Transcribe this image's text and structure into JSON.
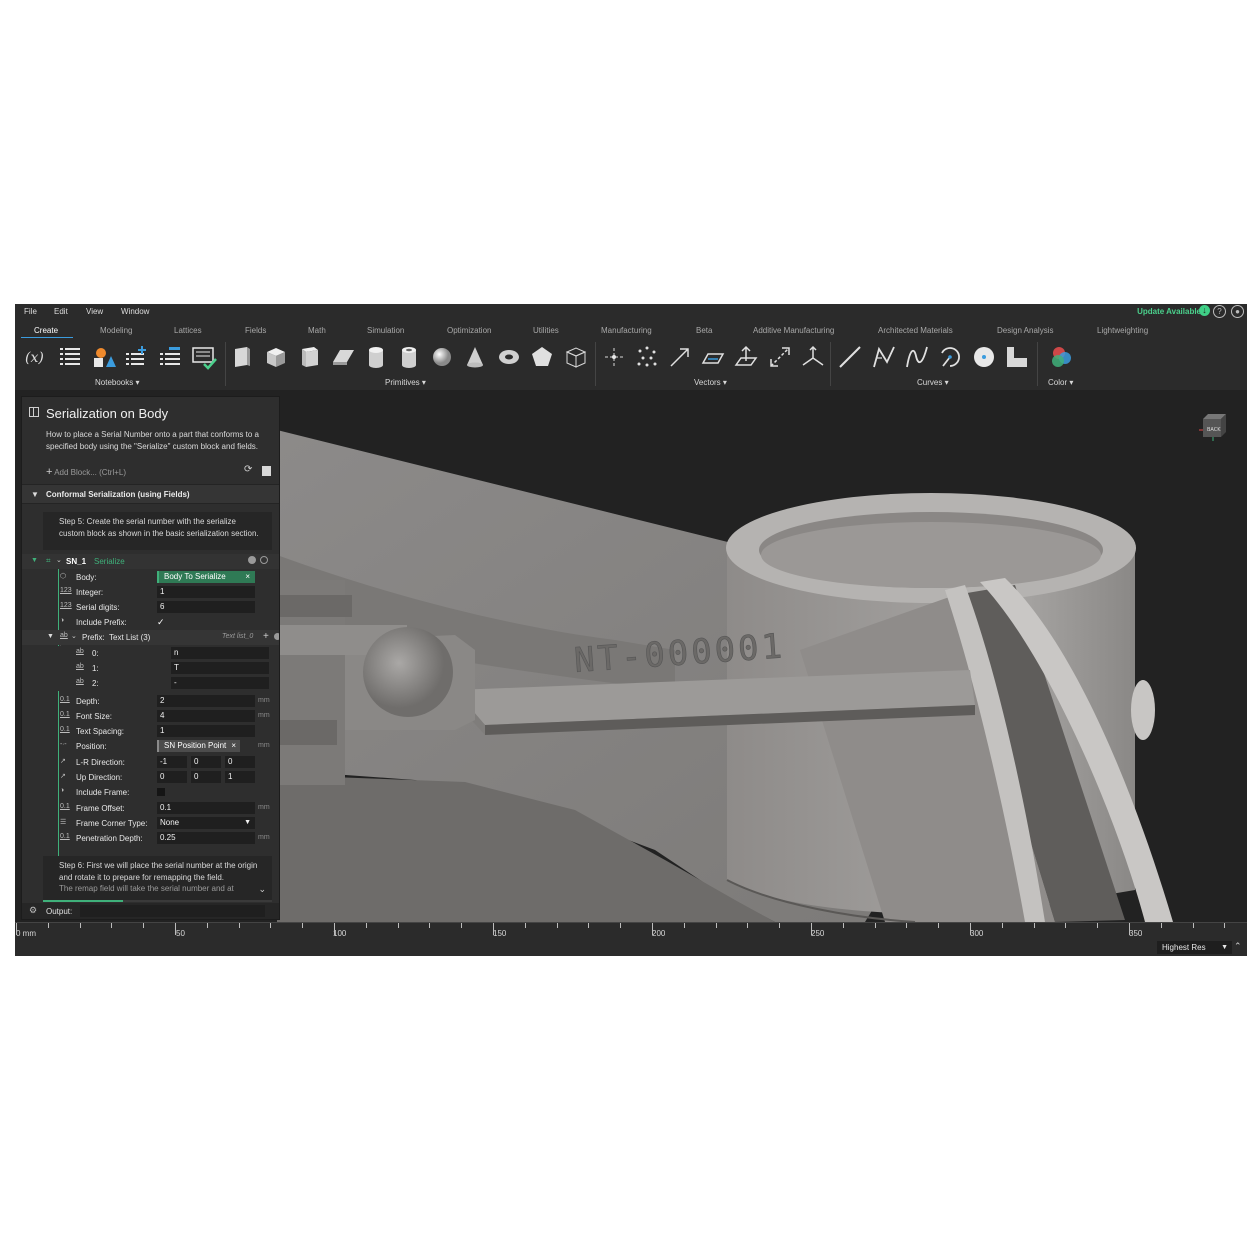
{
  "menu": [
    "File",
    "Edit",
    "View",
    "Window"
  ],
  "update_label": "Update Available",
  "tabs": [
    "Create",
    "Modeling",
    "Lattices",
    "Fields",
    "Math",
    "Simulation",
    "Optimization",
    "Utilities",
    "Manufacturing",
    "Beta",
    "Additive Manufacturing",
    "Architected Materials",
    "Design Analysis",
    "Lightweighting"
  ],
  "active_tab": "Create",
  "ribbon_groups": [
    "Notebooks",
    "Primitives",
    "Vectors",
    "Curves",
    "Color"
  ],
  "panel": {
    "title": "Serialization on Body",
    "description": "How to place a Serial Number onto a part that conforms to a specified body using the \"Serialize\" custom block and fields.",
    "add_block": "Add Block... (Ctrl+L)",
    "section": "Conformal Serialization (using Fields)",
    "step5": "Step 5: Create the serial number with the serialize custom block as shown in the basic serialization section.",
    "block_name": "SN_1",
    "block_type": "Serialize",
    "body_label": "Body:",
    "body_value": "Body To Serialize",
    "integer_label": "Integer:",
    "integer_value": "1",
    "digits_label": "Serial digits:",
    "digits_value": "6",
    "include_prefix_label": "Include Prefix:",
    "include_prefix_check": "✓",
    "prefix_label": "Prefix:",
    "prefix_type": "Text List (3)",
    "prefix_name": "Text list_0",
    "prefix_items": [
      {
        "index": "0:",
        "value": "n"
      },
      {
        "index": "1:",
        "value": "T"
      },
      {
        "index": "2:",
        "value": "-"
      }
    ],
    "depth_label": "Depth:",
    "depth_value": "2",
    "font_size_label": "Font Size:",
    "font_size_value": "4",
    "spacing_label": "Text Spacing:",
    "spacing_value": "1",
    "position_label": "Position:",
    "position_value": "SN Position Point",
    "lr_label": "L-R Direction:",
    "lr_values": [
      "-1",
      "0",
      "0"
    ],
    "up_label": "Up Direction:",
    "up_values": [
      "0",
      "0",
      "1"
    ],
    "frame_label": "Include Frame:",
    "frame_offset_label": "Frame Offset:",
    "frame_offset_value": "0.1",
    "corner_label": "Frame Corner Type:",
    "corner_value": "None",
    "pen_label": "Penetration Depth:",
    "pen_value": "0.25",
    "unit": "mm",
    "step6": "Step 6: First we will place the serial number at the origin and rotate it to prepare for remapping the field.",
    "step6_cut": "The remap field will take the serial number and at",
    "output_label": "Output:"
  },
  "model_text": "NT-000001",
  "viewcube_label": "BACK",
  "ruler": {
    "unit_label": "0 mm",
    "labels": [
      "50",
      "100",
      "150",
      "200",
      "250",
      "300",
      "350"
    ]
  },
  "resolution": "Highest Res",
  "colors": {
    "accent": "#3b9cde",
    "green": "#3fb07a",
    "update": "#4bd08c"
  }
}
